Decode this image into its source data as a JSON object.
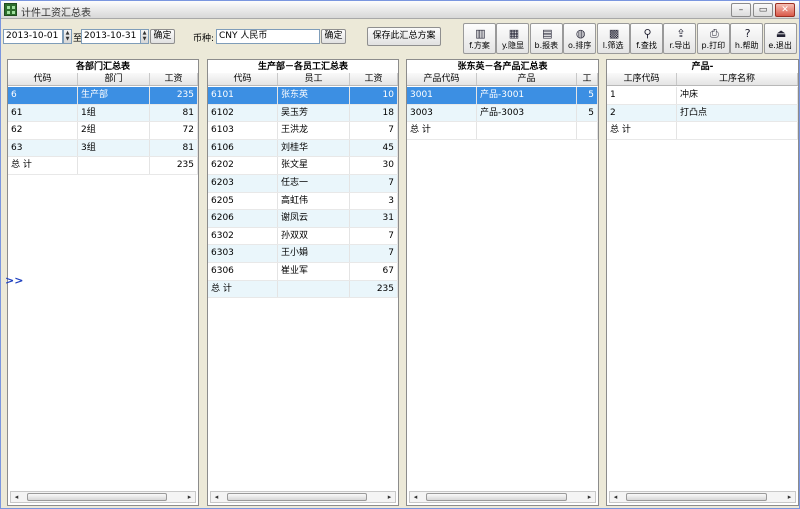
{
  "window": {
    "title": "计件工资汇总表",
    "minimize": "–",
    "restore": "▭",
    "close": "✕"
  },
  "toolbar": {
    "date_from": "2013-10-01",
    "to_label": "至",
    "date_to": "2013-10-31",
    "confirm1": "确定",
    "currency_label": "币种:",
    "currency_value": "CNY 人民币",
    "confirm2": "确定",
    "save_plan": "保存此汇总方案",
    "tools": [
      {
        "label": "f.方案",
        "icon": "plan-icon",
        "glyph": "▥"
      },
      {
        "label": "y.隐显",
        "icon": "columns-icon",
        "glyph": "▦"
      },
      {
        "label": "b.报表",
        "icon": "report-icon",
        "glyph": "▤"
      },
      {
        "label": "o.排序",
        "icon": "sort-icon",
        "glyph": "◍"
      },
      {
        "label": "l.筛选",
        "icon": "filter-icon",
        "glyph": "▩"
      },
      {
        "label": "f.查找",
        "icon": "binoculars-icon",
        "glyph": "⚲"
      },
      {
        "label": "r.导出",
        "icon": "export-icon",
        "glyph": "⇪"
      },
      {
        "label": "p.打印",
        "icon": "printer-icon",
        "glyph": "⎙"
      },
      {
        "label": "h.帮助",
        "icon": "help-icon",
        "glyph": "?"
      },
      {
        "label": "e.退出",
        "icon": "exit-icon",
        "glyph": "⏏"
      }
    ]
  },
  "expander": ">>",
  "panels": [
    {
      "title": "各部门汇总表",
      "headers": [
        "代码",
        "部门",
        "工资"
      ],
      "rows": [
        [
          "6",
          "生产部",
          "235"
        ],
        [
          "61",
          "1组",
          "81"
        ],
        [
          "62",
          "2组",
          "72"
        ],
        [
          "63",
          "3组",
          "81"
        ],
        [
          "总  计",
          "",
          "235"
        ]
      ]
    },
    {
      "title": "生产部－各员工汇总表",
      "headers": [
        "代码",
        "员工",
        "工资"
      ],
      "rows": [
        [
          "6101",
          "张东英",
          "10"
        ],
        [
          "6102",
          "吴玉芳",
          "18"
        ],
        [
          "6103",
          "王洪龙",
          "7"
        ],
        [
          "6106",
          "刘桂华",
          "45"
        ],
        [
          "6202",
          "张文星",
          "30"
        ],
        [
          "6203",
          "任志一",
          "7"
        ],
        [
          "6205",
          "高虹伟",
          "3"
        ],
        [
          "6206",
          "谢凤云",
          "31"
        ],
        [
          "6302",
          "孙双双",
          "7"
        ],
        [
          "6303",
          "王小娟",
          "7"
        ],
        [
          "6306",
          "崔业军",
          "67"
        ],
        [
          "    总  计",
          "",
          "235"
        ]
      ]
    },
    {
      "title": "张东英－各产品汇总表",
      "headers": [
        "产品代码",
        "产品",
        "工"
      ],
      "rows": [
        [
          "3001",
          "产品-3001",
          "5"
        ],
        [
          "3003",
          "产品-3003",
          "5"
        ],
        [
          "    总  计",
          "",
          ""
        ]
      ]
    },
    {
      "title": "产品-",
      "headers": [
        "工序代码",
        "工序名称"
      ],
      "rows": [
        [
          "1",
          "冲床"
        ],
        [
          "2",
          "打凸点"
        ],
        [
          "        总  计",
          ""
        ]
      ]
    }
  ]
}
